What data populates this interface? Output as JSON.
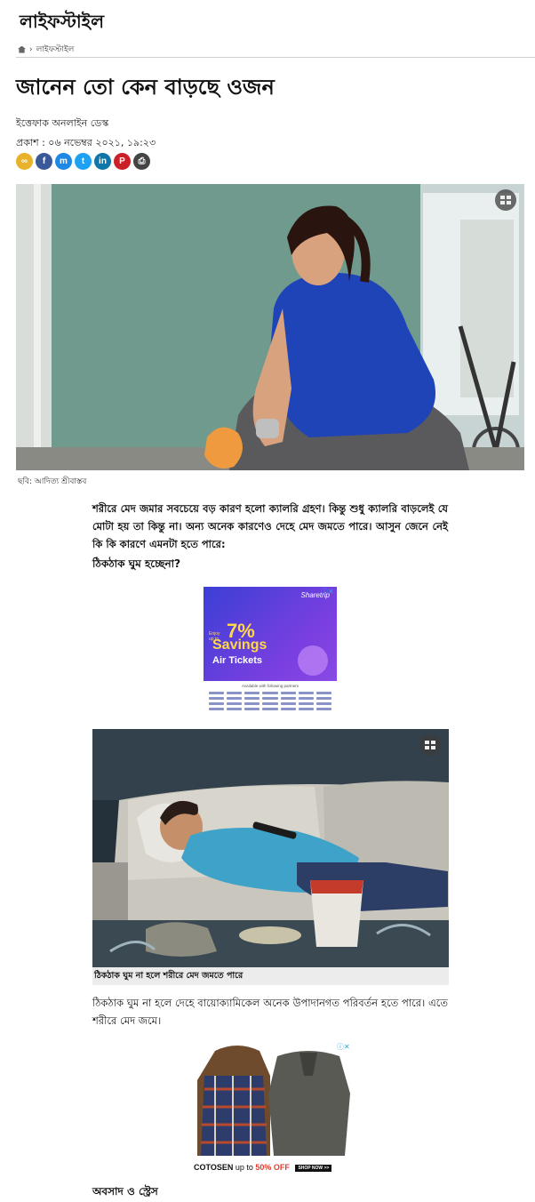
{
  "section": {
    "title": "লাইফস্টাইল"
  },
  "breadcrumb": {
    "home_icon": "home-icon",
    "separator": "›",
    "current": "লাইফস্টাইল"
  },
  "article": {
    "headline": "জানেন তো কেন বাড়ছে ওজন",
    "byline": "ইত্তেফাক অনলাইন ডেস্ক",
    "published": "প্রকাশ : ০৬ নভেম্বর ২০২১, ১৯:২৩",
    "hero_caption": "ছবি: আদিত্য শ্রীবাস্তব",
    "paragraph1": "শরীরে মেদ জমার সবচেয়ে বড় কারণ হলো ক্যালরি গ্রহণ। কিন্তু শুধু ক্যালরি বাড়লেই যে মোটা হয় তা কিন্তু না। অন্য অনেক কারণেও দেহে মেদ জমতে পারে। আসুন জেনে নেই কি কি কারণে এমনটা হতে পারে:",
    "subheading1": "ঠিকঠাক ঘুম হচ্ছেনা?",
    "image2_caption": "ঠিকঠাক ঘুম না হলে শরীরে মেদ জমতে পারে",
    "paragraph2": "ঠিকঠাক ঘুম না হলে দেহে বায়োক্যামিকেল অনেক উপাদানগত পরিবর্তন হতে পারে। এতে শরীরে মেদ জমে।",
    "subheading2": "অবসাদ ও স্ট্রেস"
  },
  "share_buttons": [
    {
      "name": "copy-link-icon",
      "glyph": "∞",
      "color": "#e8b32a"
    },
    {
      "name": "facebook-icon",
      "glyph": "f",
      "color": "#3b5998"
    },
    {
      "name": "messenger-icon",
      "glyph": "m",
      "color": "#1e88e5"
    },
    {
      "name": "twitter-icon",
      "glyph": "t",
      "color": "#1da1f2"
    },
    {
      "name": "linkedin-icon",
      "glyph": "in",
      "color": "#0e76a8"
    },
    {
      "name": "pinterest-icon",
      "glyph": "P",
      "color": "#cb2027"
    },
    {
      "name": "print-icon",
      "glyph": "⎙",
      "color": "#444444"
    }
  ],
  "ad1": {
    "brand": "Sharetrip",
    "enjoy": "Enjoy up to",
    "percent": "7%",
    "savings": "Savings",
    "tickets": "Air Tickets",
    "partners_label": "Available with following partners",
    "adchoice": "ⓘ✕"
  },
  "ad2": {
    "brand": "COTOSEN",
    "offer_prefix": "up to",
    "offer": "50% OFF",
    "cta": "SHOP NOW >>",
    "adchoice": "ⓘ✕"
  }
}
